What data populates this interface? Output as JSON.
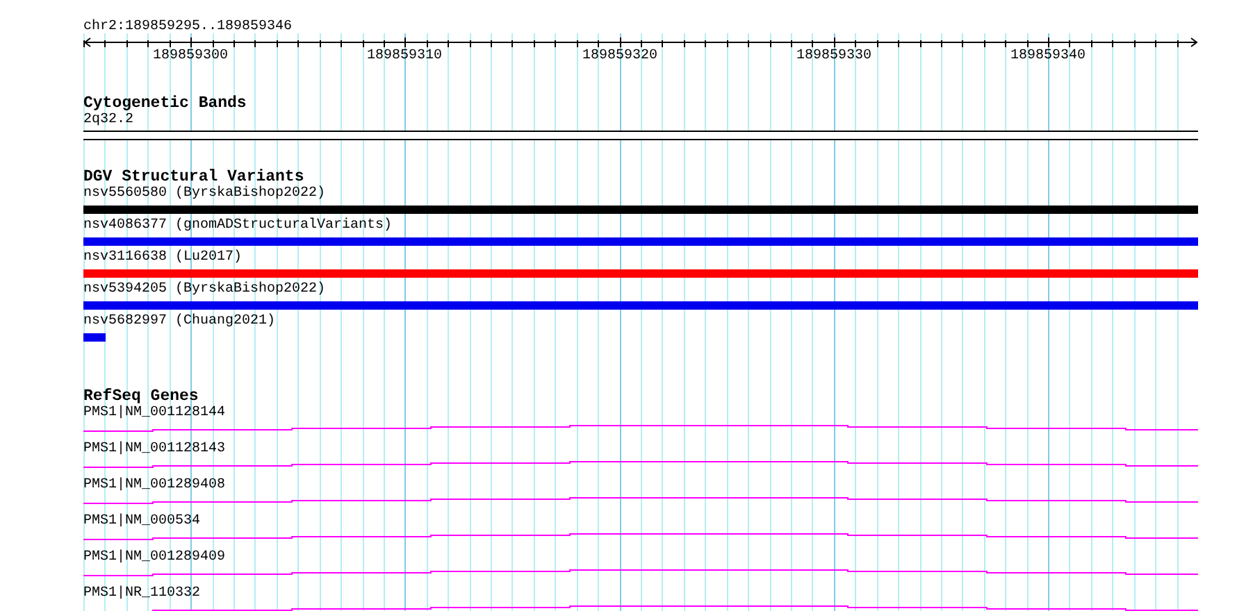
{
  "ruler": {
    "range": "chr2:189859295..189859346",
    "labels": [
      "189859300",
      "189859310",
      "189859320",
      "189859330",
      "189859340"
    ]
  },
  "tracks": [
    {
      "kind": "cytoband",
      "title": "Cytogenetic Bands",
      "items": [
        {
          "label": "2q32.2"
        }
      ]
    },
    {
      "kind": "variants",
      "title": "DGV Structural Variants",
      "items": [
        {
          "label": "nsv5560580 (ByrskaBishop2022)",
          "color": "#000000",
          "kind": "full"
        },
        {
          "label": "nsv4086377 (gnomADStructuralVariants)",
          "color": "#0000ee",
          "kind": "full"
        },
        {
          "label": "nsv3116638 (Lu2017)",
          "color": "#ff0000",
          "kind": "full"
        },
        {
          "label": "nsv5394205 (ByrskaBishop2022)",
          "color": "#0000ee",
          "kind": "full"
        },
        {
          "label": "nsv5682997 (Chuang2021)",
          "color": "#0000ee",
          "kind": "partial"
        }
      ]
    },
    {
      "kind": "genes",
      "title": "RefSeq Genes",
      "items": [
        {
          "label": "PMS1|NM_001128144"
        },
        {
          "label": "PMS1|NM_001128143"
        },
        {
          "label": "PMS1|NM_001289408"
        },
        {
          "label": "PMS1|NM_000534"
        },
        {
          "label": "PMS1|NM_001289409"
        },
        {
          "label": "PMS1|NR_110332"
        }
      ]
    }
  ]
}
